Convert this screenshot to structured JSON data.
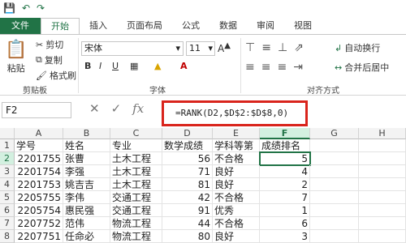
{
  "colors": {
    "accent": "#217346",
    "highlight": "#d9241c"
  },
  "qat": {
    "save_icon": "save-icon",
    "undo_icon": "undo-icon",
    "redo_icon": "redo-icon"
  },
  "tabs": [
    "文件",
    "开始",
    "插入",
    "页面布局",
    "公式",
    "数据",
    "审阅",
    "视图"
  ],
  "ribbon": {
    "paste": "粘贴",
    "cut": "剪切",
    "copy": "复制",
    "format_painter": "格式刷",
    "clipboard_group": "剪贴板",
    "font_name": "宋体",
    "font_size": "11",
    "font_group": "字体",
    "bold": "B",
    "italic": "I",
    "underline": "U",
    "wrap_text": "自动换行",
    "merge_center": "合并后居中",
    "align_group": "对齐方式"
  },
  "formula_bar": {
    "name_box": "F2",
    "fx": "fx",
    "formula": "=RANK(D2,$D$2:$D$8,0)"
  },
  "sheet": {
    "columns": [
      "A",
      "B",
      "C",
      "D",
      "E",
      "F",
      "G",
      "H"
    ],
    "rows": [
      {
        "n": "1",
        "A": "学号",
        "B": "姓名",
        "C": "专业",
        "D": "数学成绩",
        "E": "学科等第",
        "F": "成绩排名"
      },
      {
        "n": "2",
        "A": "2201755",
        "B": "张曹",
        "C": "土木工程",
        "D": "56",
        "E": "不合格",
        "F": "5"
      },
      {
        "n": "3",
        "A": "2201754",
        "B": "李强",
        "C": "土木工程",
        "D": "71",
        "E": "良好",
        "F": "4"
      },
      {
        "n": "4",
        "A": "2201753",
        "B": "姚吉吉",
        "C": "土木工程",
        "D": "81",
        "E": "良好",
        "F": "2"
      },
      {
        "n": "5",
        "A": "2205755",
        "B": "李伟",
        "C": "交通工程",
        "D": "42",
        "E": "不合格",
        "F": "7"
      },
      {
        "n": "6",
        "A": "2205754",
        "B": "惠民强",
        "C": "交通工程",
        "D": "91",
        "E": "优秀",
        "F": "1"
      },
      {
        "n": "7",
        "A": "2207752",
        "B": "范伟",
        "C": "物流工程",
        "D": "44",
        "E": "不合格",
        "F": "6"
      },
      {
        "n": "8",
        "A": "2207751",
        "B": "任命必",
        "C": "物流工程",
        "D": "80",
        "E": "良好",
        "F": "3"
      }
    ]
  }
}
